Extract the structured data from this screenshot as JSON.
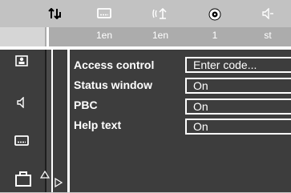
{
  "topbar": {
    "icons": [
      {
        "name": "audio-language-icon",
        "glyph": "⇅"
      },
      {
        "name": "subtitle-icon",
        "glyph": "▭"
      },
      {
        "name": "angle-icon",
        "glyph": "((↻"
      },
      {
        "name": "disc-icon",
        "glyph": "◉"
      },
      {
        "name": "speaker-icon",
        "glyph": "◁"
      }
    ],
    "labels": [
      "1en",
      "1en",
      "1",
      "st"
    ]
  },
  "menu": {
    "items": [
      {
        "label": "Access control",
        "value": "Enter code..."
      },
      {
        "label": "Status window",
        "value": "On"
      },
      {
        "label": "PBC",
        "value": "On"
      },
      {
        "label": "Help text",
        "value": "On"
      }
    ]
  },
  "sidebar": {
    "icons": [
      "person-icon",
      "speaker-icon",
      "subtitle-icon",
      "briefcase-icon"
    ]
  }
}
